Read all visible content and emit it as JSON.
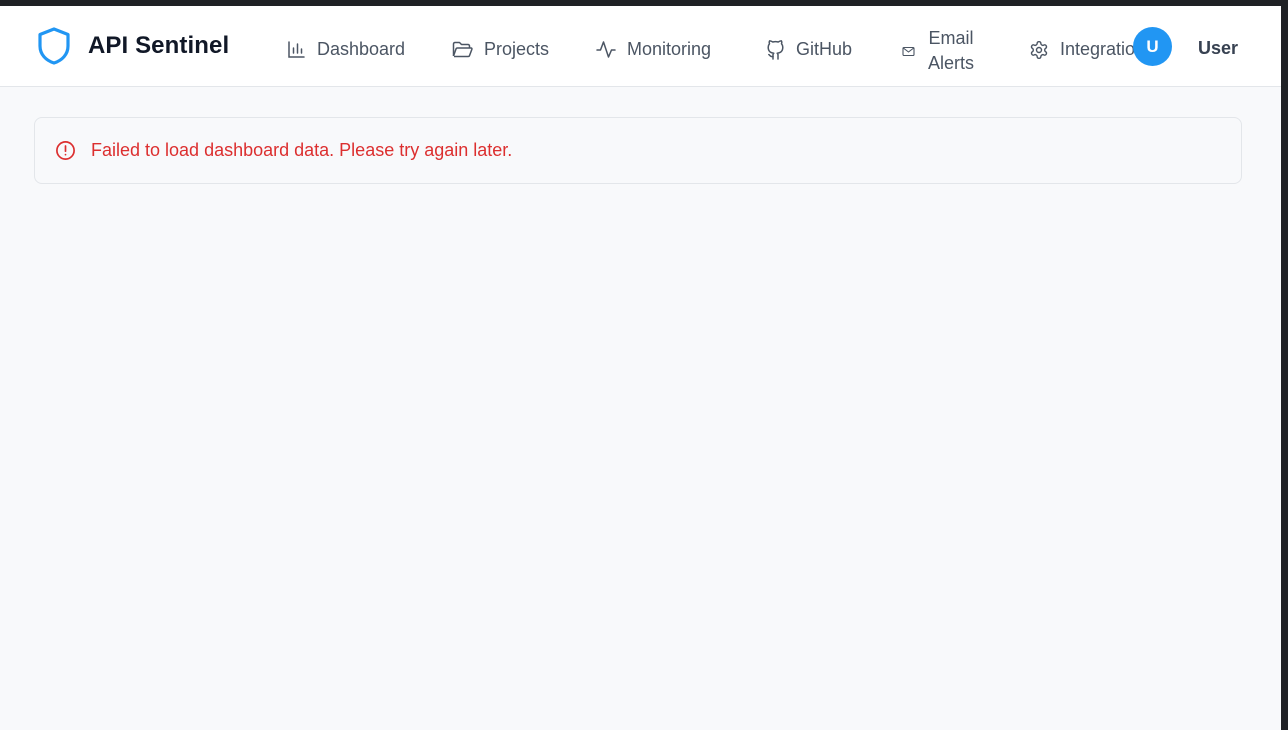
{
  "app": {
    "name": "API Sentinel",
    "brand_icon": "shield-icon",
    "brand_color": "#2196f3"
  },
  "nav": {
    "items": [
      {
        "label": "Dashboard",
        "icon": "bar-chart-icon"
      },
      {
        "label": "Projects",
        "icon": "folder-open-icon"
      },
      {
        "label": "Monitoring",
        "icon": "activity-icon"
      },
      {
        "label": "GitHub",
        "icon": "github-icon"
      },
      {
        "label": "Email Alerts",
        "icon": "mail-icon"
      },
      {
        "label": "Integrations",
        "icon": "gear-icon"
      }
    ]
  },
  "user": {
    "avatar_initial": "U",
    "name": "User",
    "avatar_color": "#2196f3"
  },
  "alert": {
    "icon": "alert-circle-icon",
    "message": "Failed to load dashboard data. Please try again later.",
    "color": "#dc2f2f"
  }
}
